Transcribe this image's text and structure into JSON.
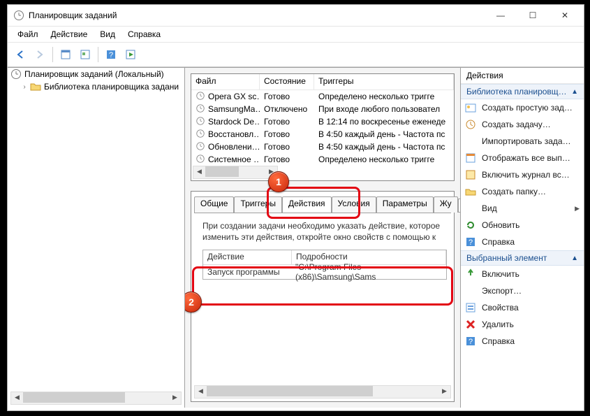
{
  "window": {
    "title": "Планировщик заданий"
  },
  "menubar": {
    "file": "Файл",
    "action": "Действие",
    "view": "Вид",
    "help": "Справка"
  },
  "tree": {
    "root": "Планировщик заданий (Локальный)",
    "child": "Библиотека планировщика задани"
  },
  "task_columns": {
    "file": "Файл",
    "state": "Состояние",
    "triggers": "Триггеры"
  },
  "tasks": [
    {
      "file": "Opera GX sc…",
      "state": "Готово",
      "trigger": "Определено несколько тригге"
    },
    {
      "file": "SamsungMa…",
      "state": "Отключено",
      "trigger": "При входе любого пользовател"
    },
    {
      "file": "Stardock De…",
      "state": "Готово",
      "trigger": "В 12:14 по воскресенье еженеде"
    },
    {
      "file": "Восстановл…",
      "state": "Готово",
      "trigger": "В 4:50 каждый день - Частота пс"
    },
    {
      "file": "Обновлени…",
      "state": "Готово",
      "trigger": "В 4:50 каждый день - Частота пс"
    },
    {
      "file": "Системное …",
      "state": "Готово",
      "trigger": "Определено несколько тригге"
    }
  ],
  "detail_tabs": {
    "general": "Общие",
    "triggers": "Триггеры",
    "actions": "Действия",
    "conditions": "Условия",
    "params": "Параметры",
    "journal": "Жу"
  },
  "detail_text_1": "При создании задачи необходимо указать действие, которое",
  "detail_text_2": "изменить эти действия, откройте окно свойств с помощью к",
  "actions_grid": {
    "col_action": "Действие",
    "col_details": "Подробности",
    "row_action": "Запуск программы",
    "row_details": "\"C:\\Program Files (x86)\\Samsung\\Sams"
  },
  "actions_pane": {
    "title": "Действия",
    "section1": "Библиотека планировщ…",
    "create_basic": "Создать простую зад…",
    "create_task": "Создать задачу…",
    "import": "Импортировать зада…",
    "showall": "Отображать все вып…",
    "enable_log": "Включить журнал вс…",
    "new_folder": "Создать папку…",
    "view": "Вид",
    "refresh": "Обновить",
    "help": "Справка",
    "section2": "Выбранный элемент",
    "enable": "Включить",
    "export": "Экспорт…",
    "props": "Свойства",
    "delete": "Удалить",
    "help2": "Справка"
  }
}
